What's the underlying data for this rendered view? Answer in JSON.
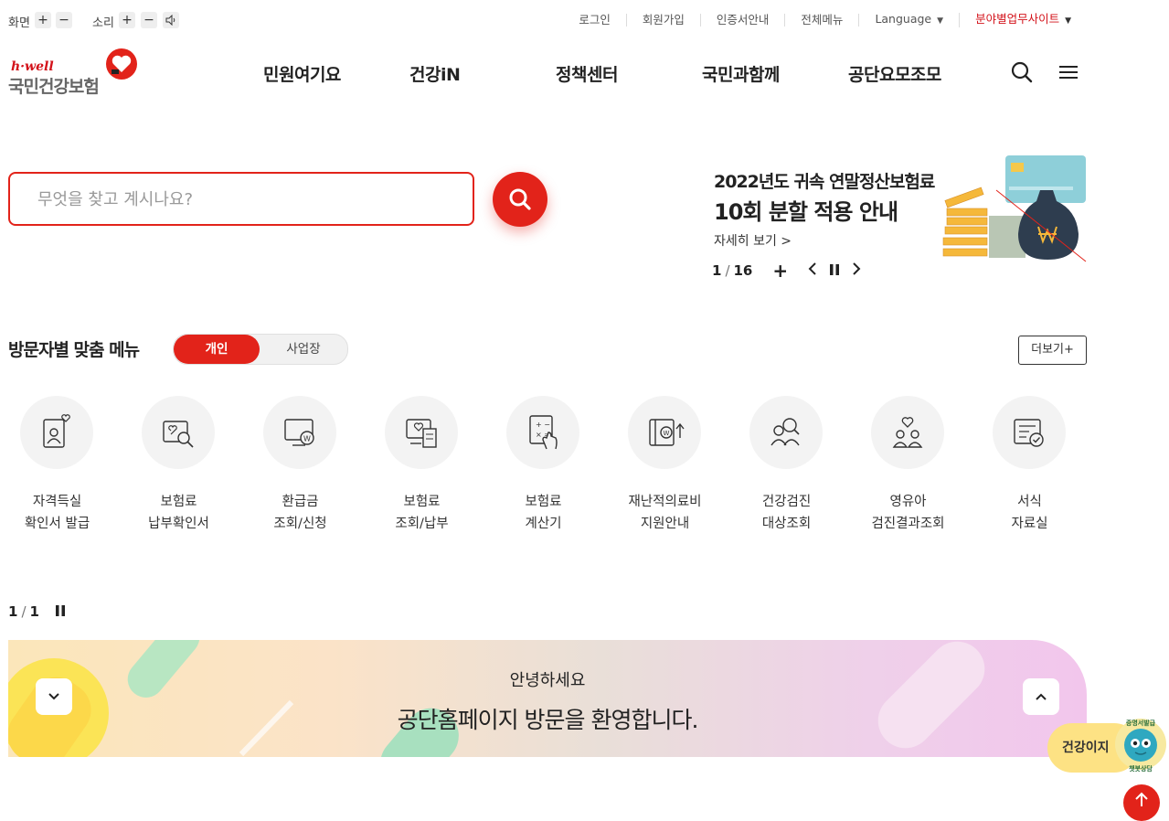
{
  "util": {
    "screen_label": "화면",
    "sound_label": "소리",
    "plus": "+",
    "minus": "−"
  },
  "top_links": {
    "login": "로그인",
    "join": "회원가입",
    "cert": "인증서안내",
    "all_menu": "전체메뉴",
    "language": "Language",
    "biz_site": "분야별업무사이트"
  },
  "logo": {
    "brand_en": "h·well",
    "brand_ko": "국민건강보험"
  },
  "nav": [
    "민원여기요",
    "건강iN",
    "정책센터",
    "국민과함께",
    "공단요모조모"
  ],
  "search": {
    "placeholder": "무엇을 찾고 계시나요?"
  },
  "banner": {
    "title_line1": "2022년도 귀속 연말정산보험료",
    "title_line2": "10회 분할 적용 안내",
    "more": "자세히 보기 >",
    "counter_current": "1",
    "counter_total": "16",
    "plus": "+"
  },
  "visitor_menu": {
    "title": "방문자별 맞춤 메뉴",
    "tab_personal": "개인",
    "tab_business": "사업장",
    "more": "더보기+",
    "items": [
      {
        "line1": "자격득실",
        "line2": "확인서 발급",
        "icon": "id-card-heart-icon"
      },
      {
        "line1": "보험료",
        "line2": "납부확인서",
        "icon": "document-search-icon"
      },
      {
        "line1": "환급금",
        "line2": "조회/신청",
        "icon": "monitor-won-icon"
      },
      {
        "line1": "보험료",
        "line2": "조회/납부",
        "icon": "receipt-heart-icon"
      },
      {
        "line1": "보험료",
        "line2": "계산기",
        "icon": "calculator-hand-icon"
      },
      {
        "line1": "재난적의료비",
        "line2": "지원안내",
        "icon": "wallet-won-up-icon"
      },
      {
        "line1": "건강검진",
        "line2": "대상조회",
        "icon": "people-search-icon"
      },
      {
        "line1": "영유아",
        "line2": "검진결과조회",
        "icon": "family-heart-icon"
      },
      {
        "line1": "서식",
        "line2": "자료실",
        "icon": "form-check-icon"
      }
    ],
    "pager_current": "1",
    "pager_total": "1"
  },
  "welcome": {
    "sub": "안녕하세요",
    "main": "공단홈페이지 방문을 환영합니다."
  },
  "chatbot": {
    "label": "건강이지",
    "badge_top": "증명서발급",
    "badge_bottom": "챗봇상담"
  },
  "colors": {
    "accent": "#e2231a",
    "text": "#222222",
    "chat": "#fde284"
  }
}
